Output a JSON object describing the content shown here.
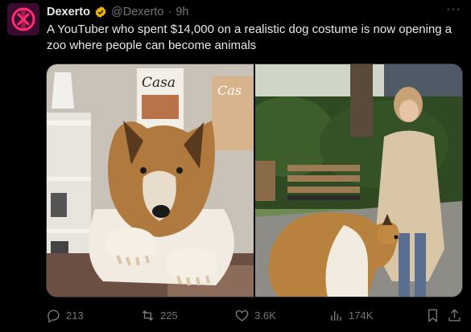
{
  "author": {
    "name": "Dexerto",
    "handle": "@Dexerto",
    "separator": "·",
    "time": "9h"
  },
  "more_icon": "···",
  "tweet": {
    "text": "A YouTuber who spent $14,000 on a realistic dog costume is now opening a zoo where people can become animals"
  },
  "media": {
    "left_image_icon": "dog-costume-photo",
    "right_image_icon": "dog-walk-photo",
    "magazine_title": "Casa",
    "magazine_title_2": "Cas"
  },
  "actions": {
    "replies": "213",
    "reposts": "225",
    "likes": "3.6K",
    "views": "174K"
  },
  "colors": {
    "background": "#000000",
    "text": "#e7e9ea",
    "muted": "#71767b",
    "verified": "#f4b400",
    "avatar_bg": "#4a0f3a",
    "avatar_accent": "#ff2e6e"
  }
}
